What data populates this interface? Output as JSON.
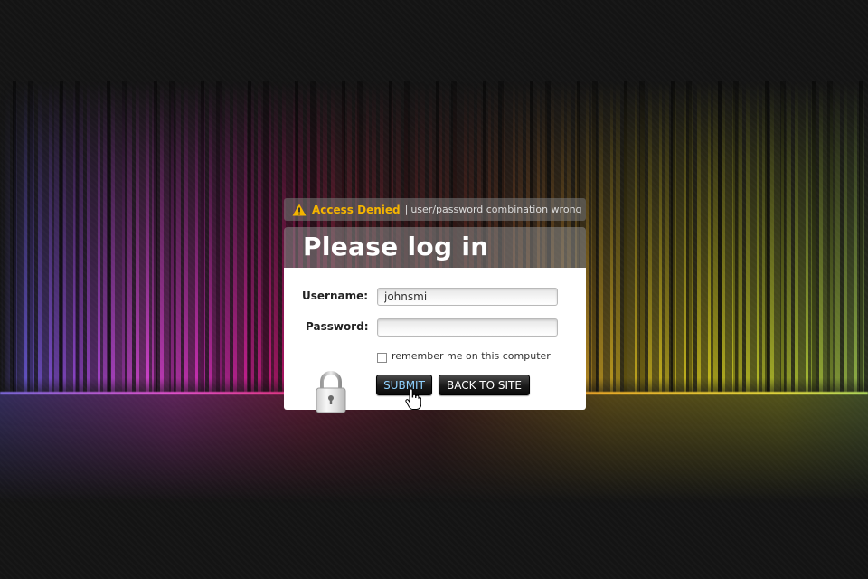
{
  "alert": {
    "title": "Access Denied",
    "separator": "|",
    "message": "user/password combination wrong",
    "icon": "warning-icon"
  },
  "login": {
    "title": "Please log in",
    "username_label": "Username:",
    "username_value": "johnsmi",
    "password_label": "Password:",
    "password_value": "",
    "remember_label": "remember me on this computer",
    "remember_checked": false,
    "submit_label": "SUBMIT",
    "back_label": "BACK TO SITE"
  },
  "colors": {
    "alert_title": "#f4b400",
    "submit_text": "#8fd2ff",
    "panel_bg": "#ffffff"
  }
}
